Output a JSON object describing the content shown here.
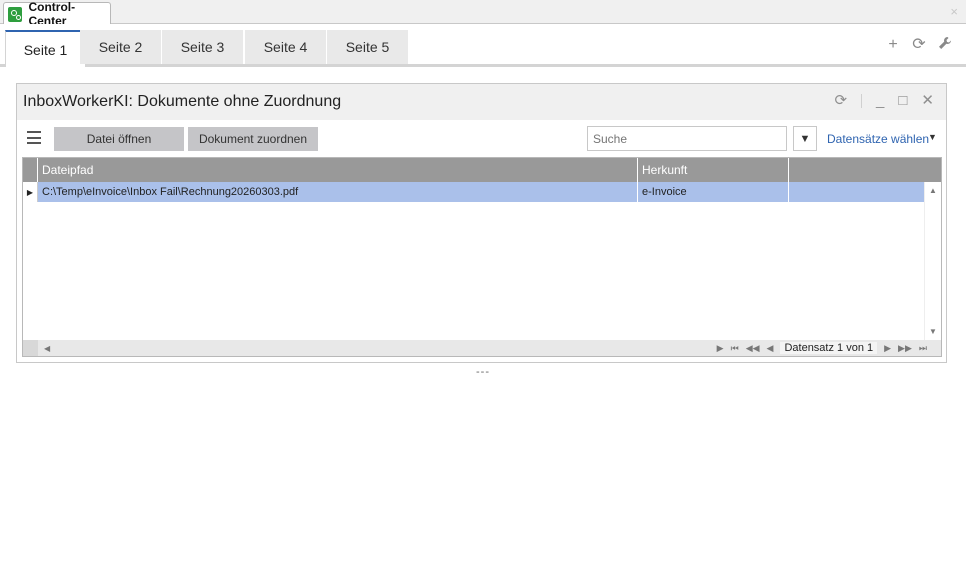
{
  "doc_tab": {
    "title": "Control-Center",
    "close_glyph": "×",
    "icon": "control-center-app-icon"
  },
  "page_tabs": [
    {
      "label": "Seite 1",
      "active": true
    },
    {
      "label": "Seite 2",
      "active": false
    },
    {
      "label": "Seite 3",
      "active": false
    },
    {
      "label": "Seite 4",
      "active": false
    },
    {
      "label": "Seite 5",
      "active": false
    }
  ],
  "tab_tools": {
    "add": "+",
    "refresh": "⟳",
    "settings": "🔧"
  },
  "widget": {
    "title": "InboxWorkerKI: Dokumente ohne Zuordnung",
    "ctrl_refresh": "⟳",
    "ctrl_minimize": "_",
    "ctrl_maximize": "□",
    "ctrl_close": "✕"
  },
  "toolbar": {
    "open_file": "Datei öffnen",
    "assign_document": "Dokument zuordnen",
    "search_placeholder": "Suche",
    "filter_glyph": "▼",
    "records_select": "Datensätze wählen",
    "records_caret": "▼"
  },
  "grid": {
    "columns": [
      "Dateipfad",
      "Herkunft",
      ""
    ],
    "rows": [
      {
        "indicator": "▶",
        "cells": [
          "C:\\Temp\\eInvoice\\Inbox Fail\\Rechnung20260303.pdf",
          "e-Invoice",
          ""
        ],
        "selected": true
      }
    ],
    "navigator": {
      "label": "Datensatz 1 von 1",
      "first": "⏮",
      "prev_page": "◀◀",
      "prev": "◀",
      "next": "▶",
      "next_page": "▶▶",
      "last": "⏭"
    },
    "scroll_up": "▲",
    "scroll_down": "▼",
    "scroll_left": "◀",
    "scroll_right": "▶"
  },
  "dragger": "---",
  "colors": {
    "accent": "#2f64b0",
    "selection": "#aac0ea",
    "header": "#999999",
    "button": "#c5c5c8"
  }
}
